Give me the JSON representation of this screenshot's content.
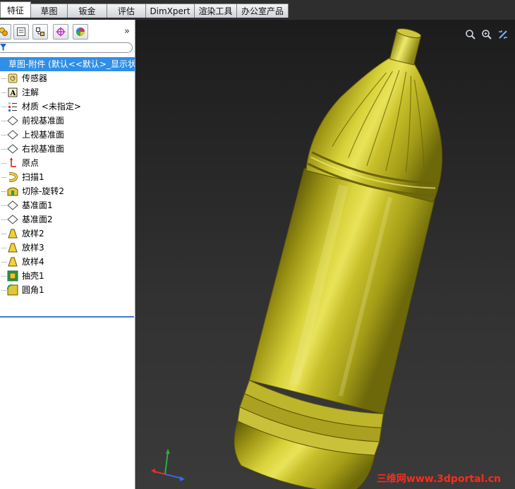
{
  "tabs": [
    {
      "label": "特征",
      "active": true
    },
    {
      "label": "草图"
    },
    {
      "label": "钣金"
    },
    {
      "label": "评估"
    },
    {
      "label": "DimXpert"
    },
    {
      "label": "渲染工具"
    },
    {
      "label": "办公室产品"
    }
  ],
  "panel": {
    "expand_glyph": "»",
    "filter_icon": "filter-icon"
  },
  "tree": {
    "root_label": "草图-附件 (默认<<默认>_显示状",
    "items": [
      {
        "label": "传感器",
        "icon": "sensor-icon"
      },
      {
        "label": "注解",
        "icon": "annotation-icon"
      },
      {
        "label": "材质 <未指定>",
        "icon": "material-icon"
      },
      {
        "label": "前视基准面",
        "icon": "plane-icon"
      },
      {
        "label": "上视基准面",
        "icon": "plane-icon"
      },
      {
        "label": "右视基准面",
        "icon": "plane-icon"
      },
      {
        "label": "原点",
        "icon": "origin-icon"
      },
      {
        "label": "扫描1",
        "icon": "sweep-icon"
      },
      {
        "label": "切除-旋转2",
        "icon": "cut-revolve-icon"
      },
      {
        "label": "基准面1",
        "icon": "plane-icon"
      },
      {
        "label": "基准面2",
        "icon": "plane-icon"
      },
      {
        "label": "放样2",
        "icon": "loft-icon"
      },
      {
        "label": "放样3",
        "icon": "loft-icon"
      },
      {
        "label": "放样4",
        "icon": "loft-icon"
      },
      {
        "label": "抽壳1",
        "icon": "shell-icon"
      },
      {
        "label": "圆角1",
        "icon": "fillet-icon"
      }
    ]
  },
  "viewport": {
    "watermark": "三维网www.3dportal.cn",
    "colors": {
      "bottle": "#c9c21a",
      "background": "#2a2a2a",
      "selection": "#2f8fe8"
    }
  }
}
